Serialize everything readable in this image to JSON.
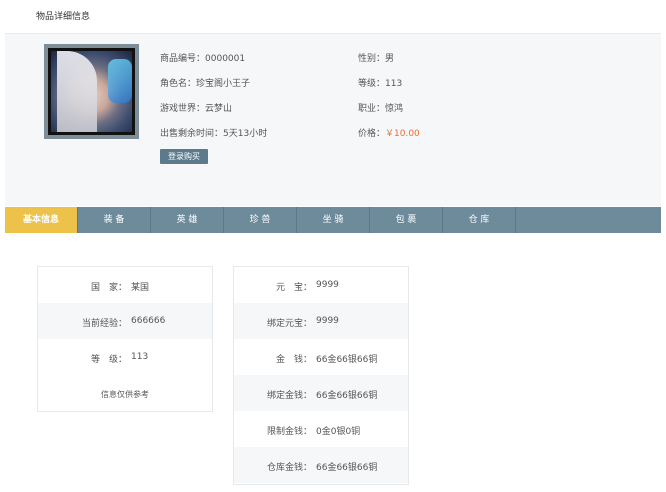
{
  "page_title": "物品详细信息",
  "item": {
    "item_no_label": "商品编号：",
    "item_no": "0000001",
    "role_label": "角色名：",
    "role_name": "珍宝阁小王子",
    "world_label": "游戏世界：",
    "world": "云梦山",
    "time_label": "出售剩余时间：",
    "time_left": "5天13小时",
    "gender_label": "性别：",
    "gender": "男",
    "level_label": "等级：",
    "level": "113",
    "job_label": "职业：",
    "job": "惊鸿",
    "price_label": "价格：",
    "price": "￥10.00",
    "buy_button": "登录购买"
  },
  "tabs": [
    "基本信息",
    "装 备",
    "英 雄",
    "珍 兽",
    "坐 骑",
    "包 裹",
    "仓 库"
  ],
  "left_card": {
    "rows": [
      {
        "label": "国　家：",
        "value": "某国"
      },
      {
        "label": "当前经验：",
        "value": "666666"
      },
      {
        "label": "等　级：",
        "value": "113"
      }
    ],
    "note": "信息仅供参考"
  },
  "right_card": {
    "rows": [
      {
        "label": "元　宝：",
        "value": "9999"
      },
      {
        "label": "绑定元宝：",
        "value": "9999"
      },
      {
        "label": "金　钱：",
        "value": "66金66银66铜"
      },
      {
        "label": "绑定金钱：",
        "value": "66金66银66铜"
      },
      {
        "label": "限制金钱：",
        "value": "0金0银0铜"
      },
      {
        "label": "仓库金钱：",
        "value": "66金66银66铜"
      }
    ]
  },
  "colors": {
    "tab_bar": "#6e8b9b",
    "tab_active": "#ecc24a",
    "price": "#f26b2a",
    "button": "#5c7a8c"
  }
}
